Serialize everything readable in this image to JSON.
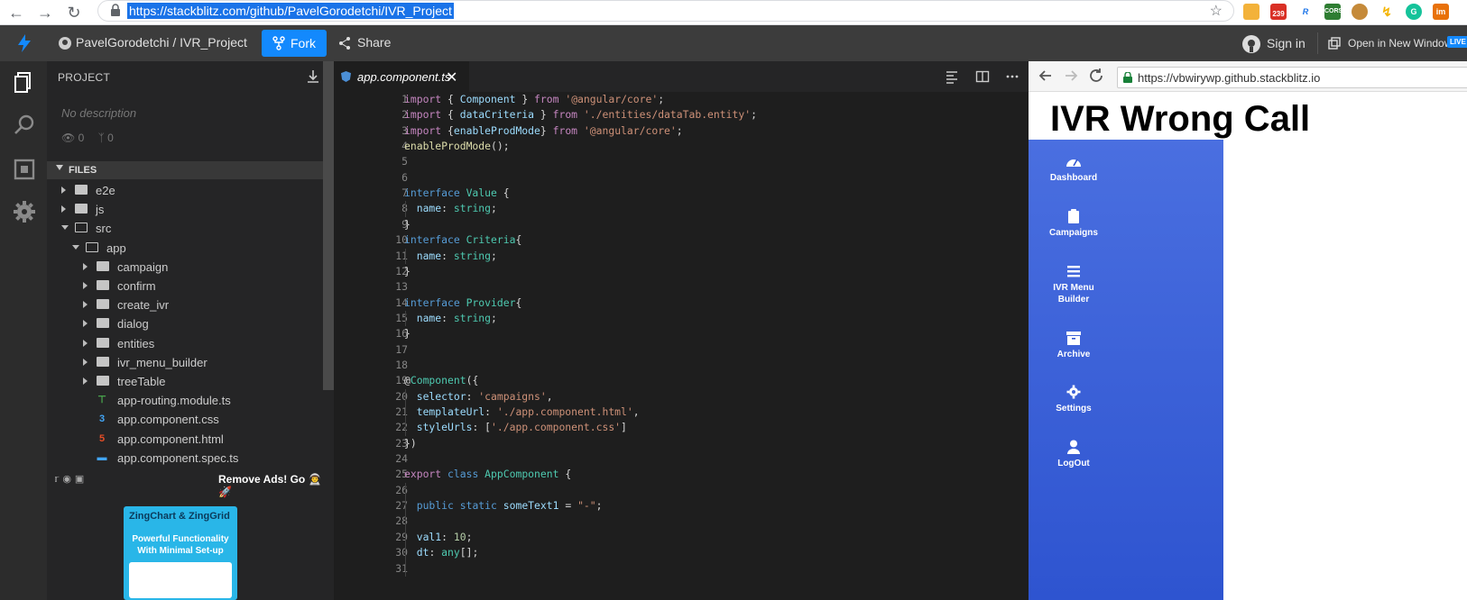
{
  "browser": {
    "url": "https://stackblitz.com/github/PavelGorodetchi/IVR_Project",
    "extensions": [
      "salad-icon",
      "calendar-239-icon",
      "r-icon",
      "cors-icon",
      "cookie-icon",
      "bolt-icon",
      "grammarly-icon",
      "im-icon"
    ],
    "calendar_badge": "239",
    "cors_label": "CORS",
    "im_label": "im"
  },
  "header": {
    "repo": "PavelGorodetchi / IVR_Project",
    "fork_label": "Fork",
    "share_label": "Share",
    "signin_label": "Sign in",
    "open_window_label": "Open in New Window",
    "live_badge": "LIVE"
  },
  "sidebar": {
    "section_title": "PROJECT",
    "description": "No description",
    "views": "0",
    "forks": "0",
    "files_title": "FILES",
    "tree": [
      {
        "name": "e2e",
        "type": "folder",
        "depth": 0,
        "expanded": false
      },
      {
        "name": "js",
        "type": "folder",
        "depth": 0,
        "expanded": false
      },
      {
        "name": "src",
        "type": "folder",
        "depth": 0,
        "expanded": true
      },
      {
        "name": "app",
        "type": "folder",
        "depth": 1,
        "expanded": true
      },
      {
        "name": "campaign",
        "type": "folder",
        "depth": 2,
        "expanded": false
      },
      {
        "name": "confirm",
        "type": "folder",
        "depth": 2,
        "expanded": false
      },
      {
        "name": "create_ivr",
        "type": "folder",
        "depth": 2,
        "expanded": false
      },
      {
        "name": "dialog",
        "type": "folder",
        "depth": 2,
        "expanded": false
      },
      {
        "name": "entities",
        "type": "folder",
        "depth": 2,
        "expanded": false
      },
      {
        "name": "ivr_menu_builder",
        "type": "folder",
        "depth": 2,
        "expanded": false
      },
      {
        "name": "treeTable",
        "type": "folder",
        "depth": 2,
        "expanded": false
      },
      {
        "name": "app-routing.module.ts",
        "type": "routing",
        "depth": 2
      },
      {
        "name": "app.component.css",
        "type": "css",
        "depth": 2
      },
      {
        "name": "app.component.html",
        "type": "html",
        "depth": 2
      },
      {
        "name": "app.component.spec.ts",
        "type": "spec",
        "depth": 2
      }
    ],
    "ads_text": "Remove Ads! Go 👨‍🚀🚀",
    "ad_brand": "ZingChart & ZingGrid",
    "ad_tagline": "Powerful Functionality With Minimal Set-up"
  },
  "editor": {
    "tab_label": "app.component.ts",
    "lines": [
      [
        [
          "import ",
          "kw"
        ],
        [
          "{ ",
          "p"
        ],
        [
          "Component",
          "id"
        ],
        [
          " } ",
          "p"
        ],
        [
          "from ",
          "kw"
        ],
        [
          "'@angular/core'",
          "str"
        ],
        [
          ";",
          "p"
        ]
      ],
      [
        [
          "import ",
          "kw"
        ],
        [
          "{ ",
          "p"
        ],
        [
          "dataCriteria",
          "id"
        ],
        [
          " } ",
          "p"
        ],
        [
          "from ",
          "kw"
        ],
        [
          "'./entities/dataTab.entity'",
          "str"
        ],
        [
          ";",
          "p"
        ]
      ],
      [
        [
          "import ",
          "kw"
        ],
        [
          "{",
          "p"
        ],
        [
          "enableProdMode",
          "id"
        ],
        [
          "} ",
          "p"
        ],
        [
          "from ",
          "kw"
        ],
        [
          "'@angular/core'",
          "str"
        ],
        [
          ";",
          "p"
        ]
      ],
      [
        [
          "enableProdMode",
          "fn"
        ],
        [
          "();",
          "p"
        ]
      ],
      [],
      [],
      [
        [
          "interface ",
          "kw2"
        ],
        [
          "Value",
          "type"
        ],
        [
          " {",
          "p"
        ]
      ],
      [
        [
          "  name",
          "id"
        ],
        [
          ": ",
          "p"
        ],
        [
          "string",
          "type"
        ],
        [
          ";",
          "p"
        ]
      ],
      [
        [
          "}",
          "p"
        ]
      ],
      [
        [
          "interface ",
          "kw2"
        ],
        [
          "Criteria",
          "type"
        ],
        [
          "{",
          "p"
        ]
      ],
      [
        [
          "  name",
          "id"
        ],
        [
          ": ",
          "p"
        ],
        [
          "string",
          "type"
        ],
        [
          ";",
          "p"
        ]
      ],
      [
        [
          "}",
          "p"
        ]
      ],
      [],
      [
        [
          "interface ",
          "kw2"
        ],
        [
          "Provider",
          "type"
        ],
        [
          "{",
          "p"
        ]
      ],
      [
        [
          "  name",
          "id"
        ],
        [
          ": ",
          "p"
        ],
        [
          "string",
          "type"
        ],
        [
          ";",
          "p"
        ]
      ],
      [
        [
          "}",
          "p"
        ]
      ],
      [],
      [],
      [
        [
          "@",
          "p"
        ],
        [
          "Component",
          "type"
        ],
        [
          "({",
          "p"
        ]
      ],
      [
        [
          "  selector",
          "id"
        ],
        [
          ": ",
          "p"
        ],
        [
          "'campaigns'",
          "str"
        ],
        [
          ",",
          "p"
        ]
      ],
      [
        [
          "  templateUrl",
          "id"
        ],
        [
          ": ",
          "p"
        ],
        [
          "'./app.component.html'",
          "str"
        ],
        [
          ",",
          "p"
        ]
      ],
      [
        [
          "  styleUrls",
          "id"
        ],
        [
          ": [",
          "p"
        ],
        [
          "'./app.component.css'",
          "str"
        ],
        [
          "]",
          "p"
        ]
      ],
      [
        [
          "})",
          "p"
        ]
      ],
      [],
      [
        [
          "export ",
          "kw"
        ],
        [
          "class ",
          "kw2"
        ],
        [
          "AppComponent",
          "type"
        ],
        [
          " {",
          "p"
        ]
      ],
      [],
      [
        [
          "  public ",
          "kw2"
        ],
        [
          "static ",
          "kw2"
        ],
        [
          "someText1",
          "id"
        ],
        [
          " = ",
          "p"
        ],
        [
          "\"-\"",
          "str"
        ],
        [
          ";",
          "p"
        ]
      ],
      [],
      [
        [
          "  val1",
          "id"
        ],
        [
          ": ",
          "p"
        ],
        [
          "10",
          "num"
        ],
        [
          ";",
          "p"
        ]
      ],
      [
        [
          "  dt",
          "id"
        ],
        [
          ": ",
          "p"
        ],
        [
          "any",
          "type"
        ],
        [
          "[];",
          "p"
        ]
      ],
      []
    ]
  },
  "preview": {
    "url": "https://vbwirywp.github.stackblitz.io",
    "title": "IVR Wrong Call",
    "nav": [
      {
        "label": "Dashboard",
        "icon": "dashboard-icon"
      },
      {
        "label": "Campaigns",
        "icon": "clipboard-icon"
      },
      {
        "label": "IVR Menu Builder",
        "icon": "menu-icon"
      },
      {
        "label": "Archive",
        "icon": "archive-icon"
      },
      {
        "label": "Settings",
        "icon": "gear-icon"
      },
      {
        "label": "LogOut",
        "icon": "user-icon"
      }
    ]
  },
  "colors": {
    "accent": "#1389fd",
    "sidebar_gradient_top": "#4a6fe0",
    "sidebar_gradient_bottom": "#2e54d0"
  }
}
